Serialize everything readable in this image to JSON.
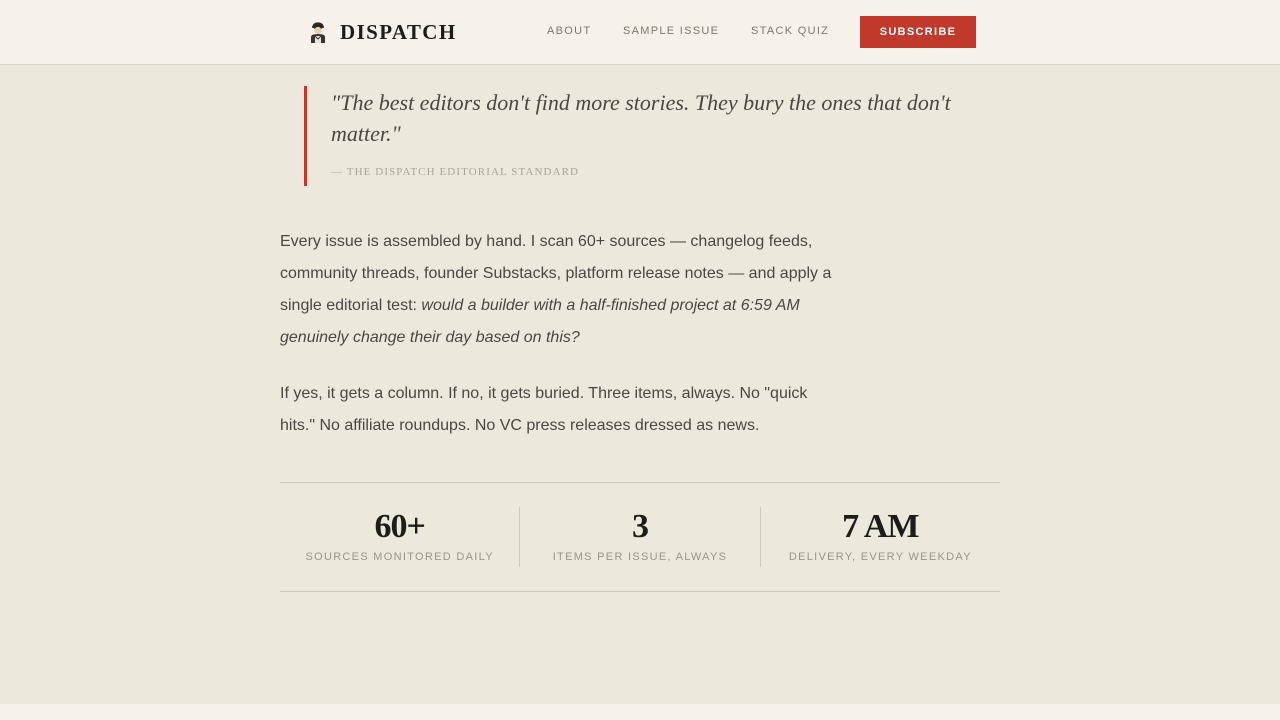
{
  "header": {
    "brand": "DISPATCH",
    "logo_icon": "newsboy-icon",
    "nav": {
      "about": "ABOUT",
      "sample_issue": "SAMPLE ISSUE",
      "stack_quiz": "STACK QUIZ"
    },
    "subscribe_label": "SUBSCRIBE"
  },
  "quote": {
    "text": "\"The best editors don't find more stories. They bury the ones that don't matter.\"",
    "attribution": "— THE DISPATCH EDITORIAL STANDARD"
  },
  "body": {
    "para1_plain": "Every issue is assembled by hand. I scan 60+ sources — changelog feeds, community threads, founder Substacks, platform release notes — and apply a single editorial test: ",
    "para1_em": "would a builder with a half-finished project at 6:59 AM genuinely change their day based on this?",
    "para2": "If yes, it gets a column. If no, it gets buried. Three items, always. No \"quick hits.\" No affiliate roundups. No VC press releases dressed as news."
  },
  "stats": [
    {
      "value": "60+",
      "label": "SOURCES MONITORED DAILY"
    },
    {
      "value": "3",
      "label": "ITEMS PER ISSUE, ALWAYS"
    },
    {
      "value": "7 AM",
      "label": "DELIVERY, EVERY WEEKDAY"
    }
  ],
  "colors": {
    "accent": "#c0392b",
    "background": "#ece8dc",
    "header_bg": "#f6f1ea",
    "ink": "#1e1c19"
  }
}
